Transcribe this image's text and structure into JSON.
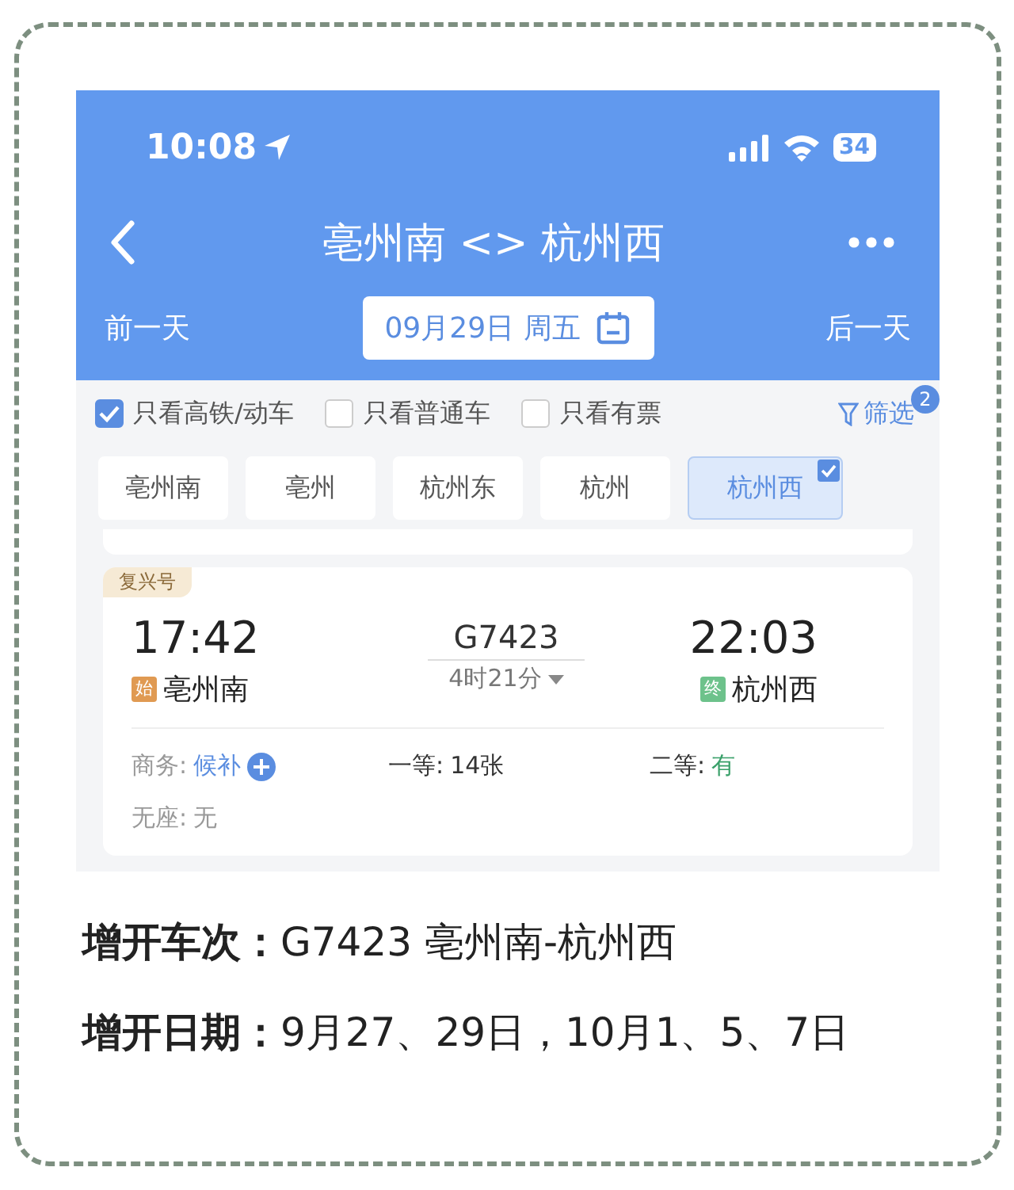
{
  "status_bar": {
    "time": "10:08",
    "battery": "34"
  },
  "nav": {
    "title": "亳州南 <> 杭州西"
  },
  "date_bar": {
    "prev": "前一天",
    "date": "09月29日 周五",
    "next": "后一天"
  },
  "filters": [
    {
      "label": "只看高铁/动车",
      "checked": true
    },
    {
      "label": "只看普通车",
      "checked": false
    },
    {
      "label": "只看有票",
      "checked": false
    }
  ],
  "filter_button": {
    "label": "筛选",
    "badge": "2"
  },
  "stations": [
    {
      "label": "亳州南",
      "selected": false
    },
    {
      "label": "亳州",
      "selected": false
    },
    {
      "label": "杭州东",
      "selected": false
    },
    {
      "label": "杭州",
      "selected": false
    },
    {
      "label": "杭州西",
      "selected": true
    }
  ],
  "train": {
    "badge": "复兴号",
    "depart_time": "17:42",
    "depart_tag": "始",
    "depart_station": "亳州南",
    "number": "G7423",
    "duration": "4时21分",
    "arrive_time": "22:03",
    "arrive_tag": "终",
    "arrive_station": "杭州西",
    "seats": [
      {
        "label": "商务:",
        "value": "候补",
        "kind": "waitlist"
      },
      {
        "label": "一等:",
        "value": "14张",
        "kind": "count"
      },
      {
        "label": "二等:",
        "value": "有",
        "kind": "available"
      },
      {
        "label": "无座:",
        "value": "无",
        "kind": "none"
      }
    ]
  },
  "notes": [
    "**增开车次：**G7423 亳州南-杭州西",
    "**增开日期：**9月27、29日，10月1、5、7日"
  ]
}
